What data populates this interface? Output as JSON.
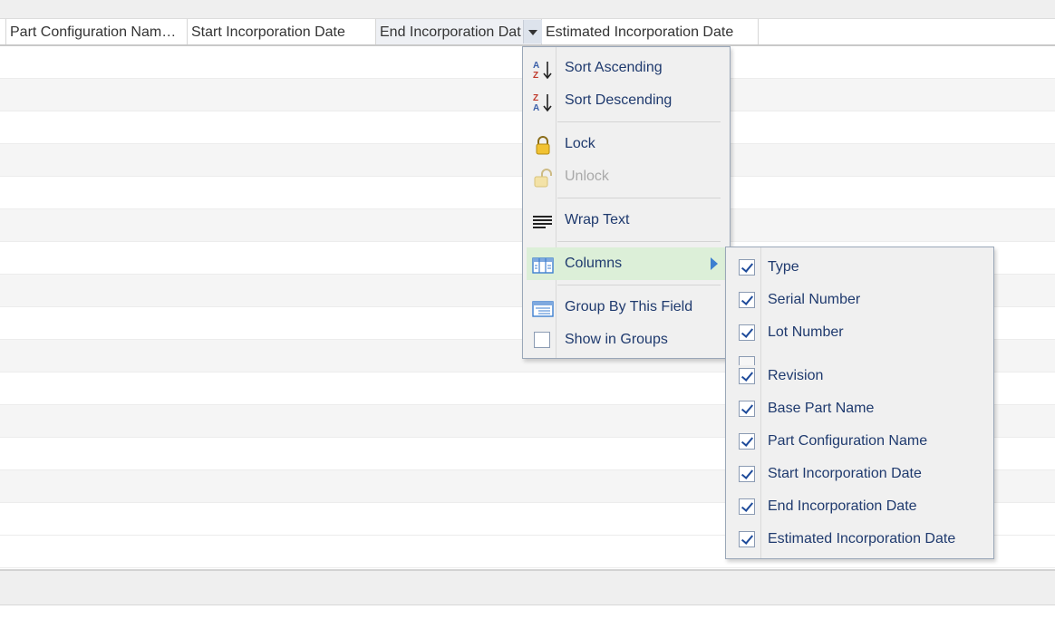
{
  "grid": {
    "headers": [
      "Part Configuration Nam…",
      "Start Incorporation Date",
      "End Incorporation Dat",
      "Estimated Incorporation Date"
    ]
  },
  "context_menu": {
    "sort_ascending": "Sort Ascending",
    "sort_descending": "Sort Descending",
    "lock": "Lock",
    "unlock": "Unlock",
    "wrap_text": "Wrap Text",
    "columns": "Columns",
    "group_by": "Group By This Field",
    "show_in_groups": "Show in Groups"
  },
  "columns_menu": {
    "items": [
      {
        "label": "Type",
        "checked": true
      },
      {
        "label": "Serial Number",
        "checked": true
      },
      {
        "label": "Lot Number",
        "checked": true
      },
      {
        "label": "Revision",
        "checked": true
      },
      {
        "label": "Base Part Name",
        "checked": true
      },
      {
        "label": "Part Configuration Name",
        "checked": true
      },
      {
        "label": "Start Incorporation Date",
        "checked": true
      },
      {
        "label": "End Incorporation Date",
        "checked": true
      },
      {
        "label": "Estimated Incorporation Date",
        "checked": true
      }
    ]
  },
  "colors": {
    "menu_text": "#1f3a6e",
    "active_highlight": "#dcefd8",
    "submenu_arrow": "#3d7fd0"
  },
  "icons": [
    "sort-ascending-icon",
    "sort-descending-icon",
    "lock-icon",
    "unlock-icon",
    "wrap-text-icon",
    "columns-icon",
    "group-by-icon",
    "checkbox-icon",
    "chevron-right-icon",
    "dropdown-arrow-icon"
  ]
}
